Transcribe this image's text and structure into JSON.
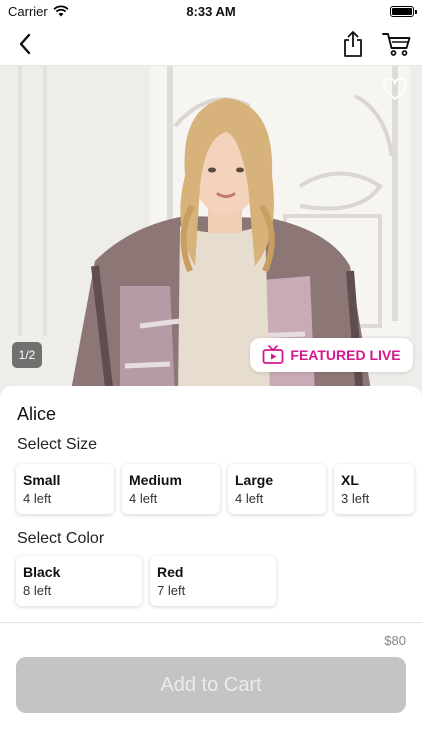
{
  "status_bar": {
    "carrier": "Carrier",
    "time": "8:33 AM"
  },
  "nav": {
    "back_icon": "chevron-left-icon",
    "share_icon": "share-icon",
    "cart_icon": "cart-icon"
  },
  "hero": {
    "page_indicator": "1/2",
    "featured_label": "FEATURED LIVE",
    "featured_color": "#d6178f"
  },
  "product": {
    "name": "Alice",
    "size_label": "Select Size",
    "sizes": [
      {
        "name": "Small",
        "stock": "4 left"
      },
      {
        "name": "Medium",
        "stock": "4 left"
      },
      {
        "name": "Large",
        "stock": "4 left"
      },
      {
        "name": "XL",
        "stock": "3 left"
      }
    ],
    "color_label": "Select Color",
    "colors": [
      {
        "name": "Black",
        "stock": "8 left"
      },
      {
        "name": "Red",
        "stock": "7 left"
      }
    ],
    "price": "$80"
  },
  "cta": {
    "add_to_cart": "Add to Cart"
  }
}
